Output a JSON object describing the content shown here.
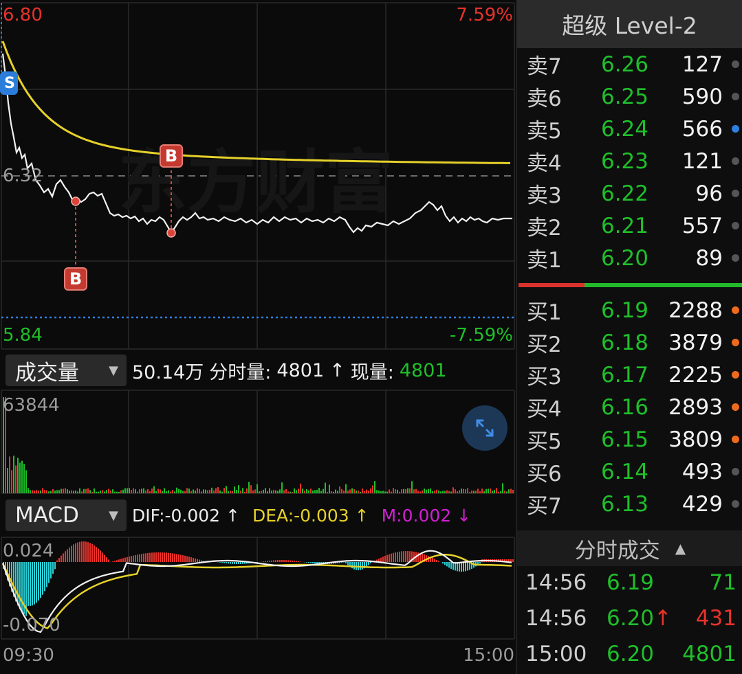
{
  "price_chart": {
    "high_price": "6.80",
    "high_pct": "7.59%",
    "prev_close": "6.32",
    "low_price": "5.84",
    "low_pct": "-7.59%",
    "watermark": "东方财富",
    "markers": {
      "sell": "S",
      "buy": "B"
    },
    "colors": {
      "price_line": "#f2f2f2",
      "avg_line": "#e6d12a",
      "up": "#e8322b",
      "down": "#1fbf2a",
      "limit_line": "#2f7fe0"
    }
  },
  "volume_panel": {
    "selector_label": "成交量",
    "total": "50.14万",
    "fenshi_label": "分时量:",
    "fenshi_value": "4801",
    "fenshi_arrow": "↑",
    "current_label": "现量:",
    "current_value": "4801",
    "max_label": "63844",
    "expand_icon": "expand-arrows-icon"
  },
  "macd_panel": {
    "selector_label": "MACD",
    "dif": "DIF:-0.002 ↑",
    "dea": "DEA:-0.003 ↑",
    "m": "M:0.002 ↓",
    "top_label": "0.024",
    "bottom_label": "-0.070",
    "colors": {
      "dif": "#f2f2f2",
      "dea": "#e6d12a",
      "m": "#d21fd2"
    }
  },
  "time_axis": {
    "start": "09:30",
    "end": "15:00"
  },
  "order_book": {
    "title": "超级 Level-2",
    "asks": [
      {
        "label": "卖7",
        "price": "6.26",
        "qty": "127",
        "dot": "#555555"
      },
      {
        "label": "卖6",
        "price": "6.25",
        "qty": "590",
        "dot": "#555555"
      },
      {
        "label": "卖5",
        "price": "6.24",
        "qty": "566",
        "dot": "#2f7fe0"
      },
      {
        "label": "卖4",
        "price": "6.23",
        "qty": "121",
        "dot": "#555555"
      },
      {
        "label": "卖3",
        "price": "6.22",
        "qty": "96",
        "dot": "#555555"
      },
      {
        "label": "卖2",
        "price": "6.21",
        "qty": "557",
        "dot": "#555555"
      },
      {
        "label": "卖1",
        "price": "6.20",
        "qty": "89",
        "dot": "#555555"
      }
    ],
    "bids": [
      {
        "label": "买1",
        "price": "6.19",
        "qty": "2288",
        "dot": "#ef6a1c"
      },
      {
        "label": "买2",
        "price": "6.18",
        "qty": "3879",
        "dot": "#ef6a1c"
      },
      {
        "label": "买3",
        "price": "6.17",
        "qty": "2225",
        "dot": "#ef6a1c"
      },
      {
        "label": "买4",
        "price": "6.16",
        "qty": "2893",
        "dot": "#ef6a1c"
      },
      {
        "label": "买5",
        "price": "6.15",
        "qty": "3809",
        "dot": "#ef6a1c"
      },
      {
        "label": "买6",
        "price": "6.14",
        "qty": "493",
        "dot": "#555555"
      },
      {
        "label": "买7",
        "price": "6.13",
        "qty": "429",
        "dot": "#555555"
      }
    ]
  },
  "ticks": {
    "title": "分时成交",
    "rows": [
      {
        "time": "14:56",
        "price": "6.19",
        "vol": "71",
        "vol_color": "#1fbf2a"
      },
      {
        "time": "14:56",
        "price": "6.20↑",
        "vol": "431",
        "vol_color": "#e8322b"
      },
      {
        "time": "15:00",
        "price": "6.20",
        "vol": "4801",
        "vol_color": "#1fbf2a"
      }
    ]
  }
}
